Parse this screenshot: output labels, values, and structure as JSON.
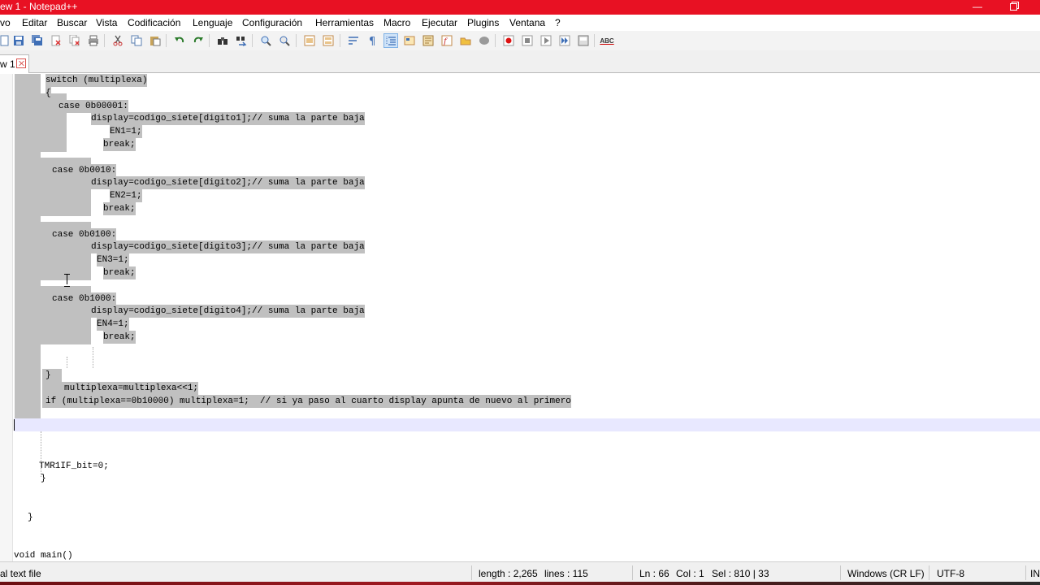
{
  "window": {
    "title": "ew 1 - Notepad++",
    "accent_color": "#e81123",
    "minimize_glyph": "—"
  },
  "menu": {
    "items": [
      "vo",
      "Editar",
      "Buscar",
      "Vista",
      "Codificación",
      "Lenguaje",
      "Configuración",
      "Herramientas",
      "Macro",
      "Ejecutar",
      "Plugins",
      "Ventana",
      "?"
    ]
  },
  "toolbar": {
    "icons": [
      "new-file-icon",
      "save-icon",
      "save-all-icon",
      "close-icon",
      "close-all-icon",
      "print-icon",
      "cut-icon",
      "copy-icon",
      "paste-icon",
      "undo-icon",
      "redo-icon",
      "find-icon",
      "replace-icon",
      "zoom-in-icon",
      "zoom-out-icon",
      "sync-vertical-icon",
      "sync-horizontal-icon",
      "word-wrap-icon",
      "show-all-chars-icon",
      "indent-guide-icon",
      "user-language-icon",
      "document-map-icon",
      "function-list-icon",
      "folder-workspace-icon",
      "monitoring-icon",
      "record-macro-icon",
      "stop-macro-icon",
      "play-macro-icon",
      "run-macro-multiple-icon",
      "save-macro-icon",
      "spell-check-icon"
    ],
    "spell_check_label": "ABC"
  },
  "tabs": [
    {
      "label": "w 1",
      "active": true
    }
  ],
  "editor": {
    "selection_color": "#c0c0c0",
    "current_line_color": "#e8e8ff",
    "lines": [
      "switch (multiplexa)",
      "{",
      "case 0b00001:",
      "display=codigo_siete[digito1];// suma la parte baja",
      "EN1=1;",
      "break;",
      "",
      "case 0b0010:",
      "display=codigo_siete[digito2];// suma la parte baja",
      "EN2=1;",
      "break;",
      "",
      "case 0b0100:",
      "display=codigo_siete[digito3];// suma la parte baja",
      "EN3=1;",
      "break;",
      "",
      "case 0b1000:",
      "display=codigo_siete[digito4];// suma la parte baja",
      "EN4=1;",
      "break;",
      "",
      "",
      "}",
      "multiplexa=multiplexa<<1;",
      "if (multiplexa==0b10000) multiplexa=1;  // si ya paso al cuarto display apunta de nuevo al primero",
      "",
      "",
      "",
      "",
      "TMR1IF_bit=0;",
      "}",
      "",
      "",
      "}",
      "",
      "",
      "void main()"
    ]
  },
  "status": {
    "file_type": "al text file",
    "length": "length : 2,265",
    "lines": "lines : 115",
    "position_ln": "Ln : 66",
    "position_col": "Col : 1",
    "selection": "Sel : 810 | 33",
    "eol": "Windows (CR LF)",
    "encoding": "UTF-8",
    "mode": "IN"
  }
}
